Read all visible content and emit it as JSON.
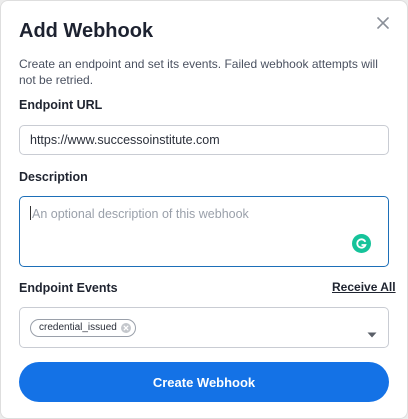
{
  "modal": {
    "title": "Add Webhook",
    "subtitle": "Create an endpoint and set its events. Failed webhook attempts will not be retried.",
    "close_icon": "close-icon"
  },
  "endpoint_url": {
    "label": "Endpoint URL",
    "value": "https://www.successoinstitute.com"
  },
  "description": {
    "label": "Description",
    "placeholder": "An optional description of this webhook",
    "value": "",
    "extension_icon": "grammarly-icon"
  },
  "endpoint_events": {
    "label": "Endpoint Events",
    "receive_all_label": "Receive All",
    "selected": [
      "credential_issued"
    ],
    "chip_remove_icon": "remove-chip-icon",
    "dropdown_icon": "chevron-down-icon"
  },
  "actions": {
    "create_label": "Create Webhook"
  },
  "colors": {
    "primary": "#1472e6",
    "focus_border": "#1d6fb8",
    "grammarly": "#15c39a"
  }
}
